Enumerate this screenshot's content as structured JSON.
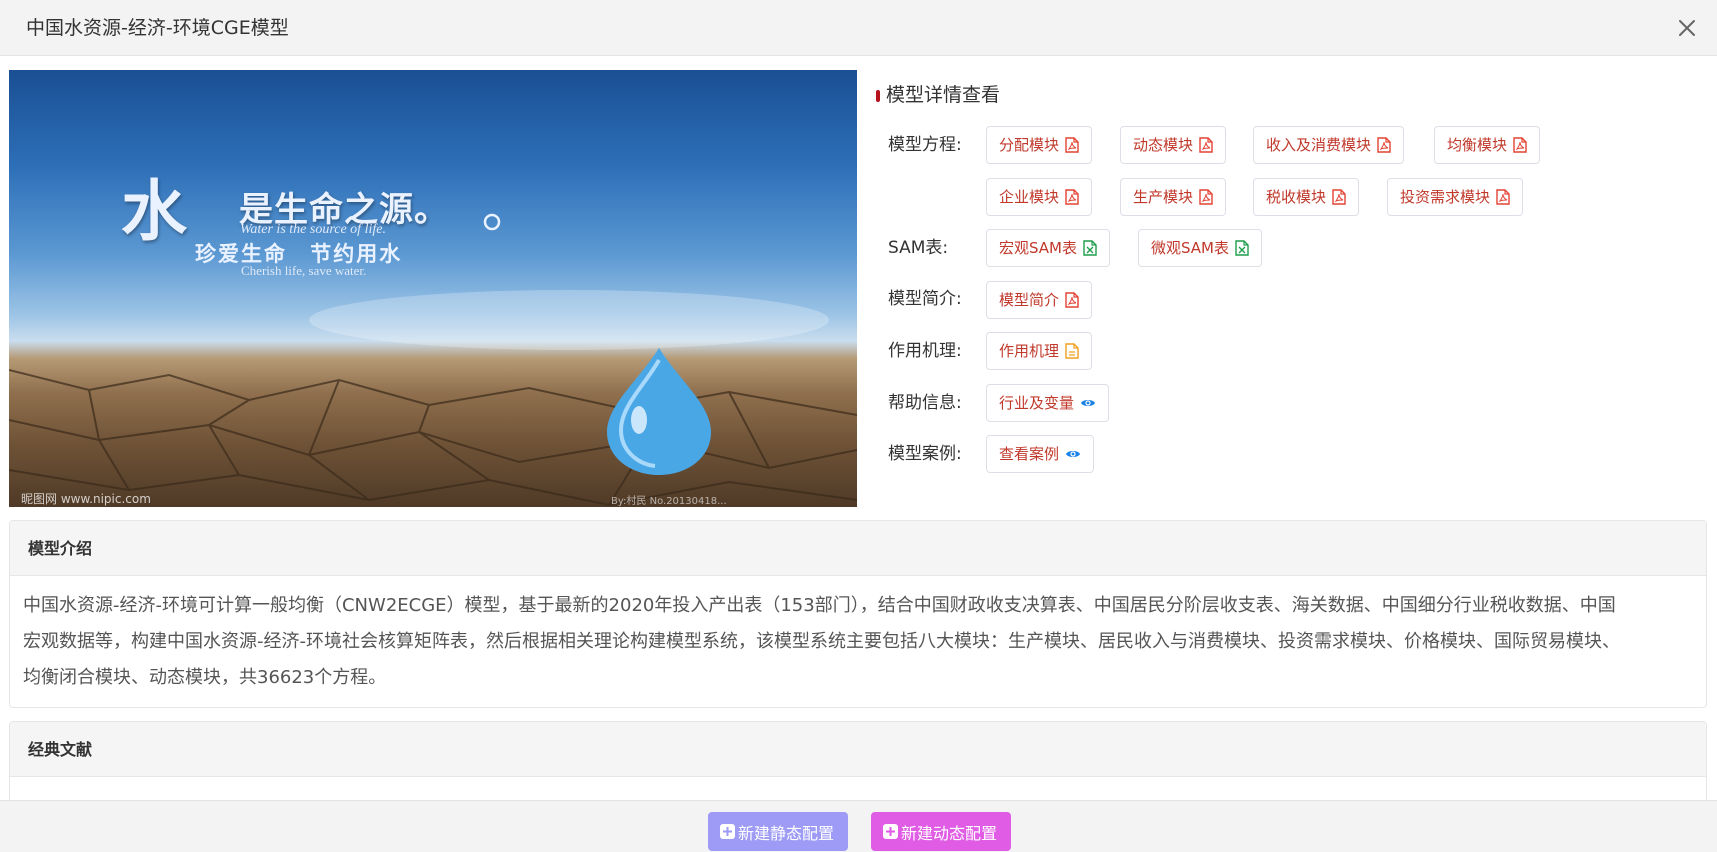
{
  "header": {
    "title": "中国水资源-经济-环境CGE模型"
  },
  "banner": {
    "big_char": "水",
    "headline": "是生命之源。",
    "english_line1": "Water is the source of life.",
    "headline2": "珍爱生命 节约用水",
    "english_line2": "Cherish life, save water.",
    "watermark_left": "昵图网 www.nipic.com",
    "watermark_right": "By:村民 No.20130418..."
  },
  "details": {
    "title": "模型详情查看",
    "rows": [
      {
        "label": "模型方程:",
        "buttons": [
          "分配模块",
          "动态模块",
          "收入及消费模块",
          "均衡模块",
          "企业模块",
          "生产模块",
          "税收模块",
          "投资需求模块"
        ]
      },
      {
        "label": "SAM表:",
        "buttons": [
          "宏观SAM表",
          "微观SAM表"
        ]
      },
      {
        "label": "模型简介:",
        "buttons": [
          "模型简介"
        ]
      },
      {
        "label": "作用机理:",
        "buttons": [
          "作用机理"
        ]
      },
      {
        "label": "帮助信息:",
        "buttons": [
          "行业及变量"
        ]
      },
      {
        "label": "模型案例:",
        "buttons": [
          "查看案例"
        ]
      }
    ]
  },
  "intro": {
    "title": "模型介绍",
    "lines": [
      "中国水资源-经济-环境可计算一般均衡（CNW2ECGE）模型，基于最新的2020年投入产出表（153部门），结合中国财政收支决算表、中国居民分阶层收支表、海关数据、中国细分行业税收数据、中国",
      "宏观数据等，构建中国水资源-经济-环境社会核算矩阵表，然后根据相关理论构建模型系统，该模型系统主要包括八大模块：生产模块、居民收入与消费模块、投资需求模块、价格模块、国际贸易模块、",
      "均衡闭合模块、动态模块，共36623个方程。"
    ]
  },
  "literature": {
    "title": "经典文献"
  },
  "footer": {
    "static_btn": "新建静态配置",
    "dynamic_btn": "新建动态配置"
  },
  "colors": {
    "accent_red": "#b5121b",
    "pdf_red": "#e34234",
    "excel_green": "#1e9e4a",
    "doc_orange": "#f0a020",
    "eye_blue": "#1b82e8",
    "static_purple": "#9d9bf5",
    "dynamic_pink": "#e05ce5"
  }
}
